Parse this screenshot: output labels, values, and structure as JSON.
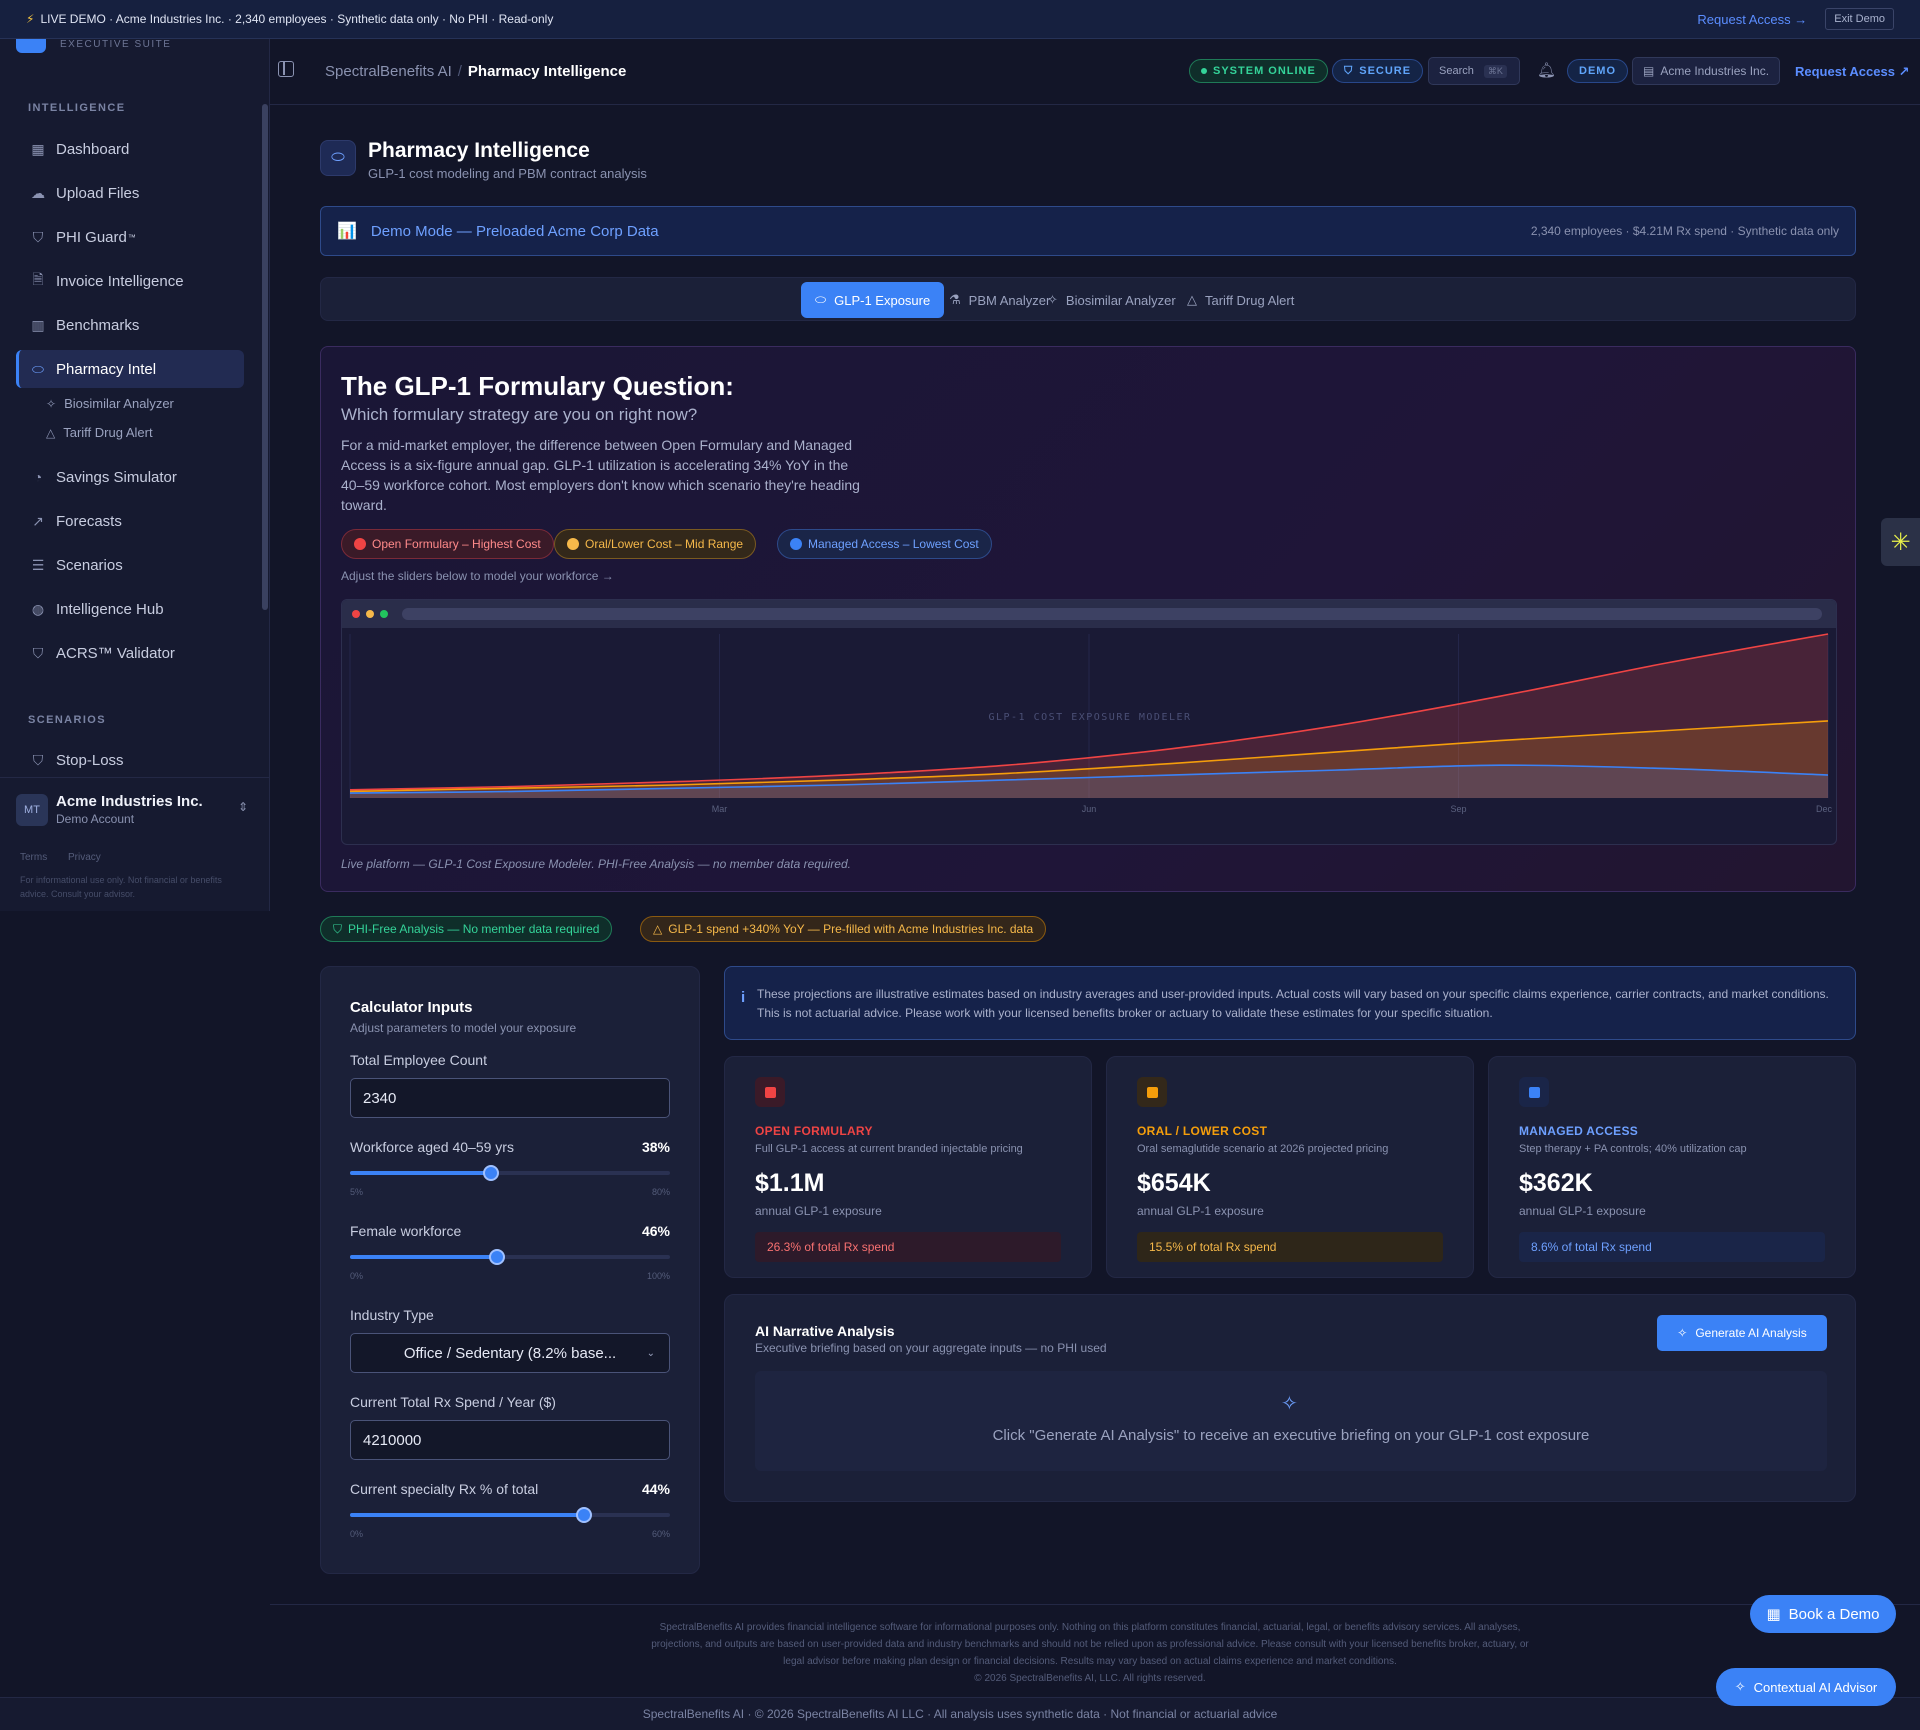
{
  "banner": {
    "text": "LIVE DEMO · Acme Industries Inc. · 2,340 employees · Synthetic data only · No PHI · Read-only",
    "request_access": "Request Access →",
    "exit_demo": "Exit Demo"
  },
  "sidebar": {
    "logo_sub": "EXECUTIVE SUITE",
    "section_intelligence": "INTELLIGENCE",
    "items": [
      {
        "label": "Dashboard",
        "icon": "grid-icon"
      },
      {
        "label": "Upload Files",
        "icon": "cloud-upload-icon"
      },
      {
        "label": "PHI Guard",
        "icon": "shield-icon",
        "sup": "™"
      },
      {
        "label": "Invoice Intelligence",
        "icon": "file-search-icon"
      },
      {
        "label": "Benchmarks",
        "icon": "bar-chart-icon"
      },
      {
        "label": "Pharmacy Intel",
        "icon": "pill-icon"
      },
      {
        "label": "Savings Simulator",
        "icon": "piggy-bank-icon"
      },
      {
        "label": "Forecasts",
        "icon": "trending-up-icon"
      },
      {
        "label": "Scenarios",
        "icon": "list-icon"
      },
      {
        "label": "Intelligence Hub",
        "icon": "globe-icon"
      },
      {
        "label": "ACRS™ Validator",
        "icon": "shield-check-icon"
      }
    ],
    "sub_items": [
      {
        "label": "Biosimilar Analyzer",
        "icon": "sparkle-icon"
      },
      {
        "label": "Tariff Drug Alert",
        "icon": "warning-icon"
      }
    ],
    "section_scenarios": "SCENARIOS",
    "stop_loss": "Stop-Loss",
    "account": {
      "initials": "MT",
      "name": "Acme Industries Inc.",
      "subtitle": "Demo Account"
    },
    "footer_links": [
      "Terms",
      "Privacy"
    ],
    "footer_disclaimer": "For informational use only. Not financial or benefits advice. Consult your advisor."
  },
  "header": {
    "crumb_root": "SpectralBenefits AI",
    "crumb_sep": "/",
    "crumb_current": "Pharmacy Intelligence",
    "status_online": "SYSTEM ONLINE",
    "status_secure": "SECURE",
    "search_label": "Search",
    "search_kbd": "⌘K",
    "demo_pill": "DEMO",
    "org": "Acme Industries Inc.",
    "request_access": "Request Access"
  },
  "page": {
    "title": "Pharmacy Intelligence",
    "subtitle": "GLP-1 cost modeling and PBM contract analysis",
    "demo_mode": "Demo Mode — Preloaded Acme Corp Data",
    "demo_meta": "2,340 employees · $4.21M Rx spend · Synthetic data only"
  },
  "tabs": [
    {
      "label": "GLP-1 Exposure",
      "icon": "pill-icon"
    },
    {
      "label": "PBM Analyzer",
      "icon": "flask-icon"
    },
    {
      "label": "Biosimilar Analyzer",
      "icon": "sparkle-icon"
    },
    {
      "label": "Tariff Drug Alert",
      "icon": "warning-icon"
    }
  ],
  "hero": {
    "title": "The GLP-1 Formulary Question:",
    "question": "Which formulary strategy are you on right now?",
    "body": "For a mid-market employer, the difference between Open Formulary and Managed Access is a six-figure annual gap. GLP-1 utilization is accelerating 34% YoY in the 40–59 workforce cohort. Most employers don't know which scenario they're heading toward.",
    "chip_open": "Open Formulary – Highest Cost",
    "chip_oral": "Oral/Lower Cost – Mid Range",
    "chip_managed": "Managed Access – Lowest Cost",
    "hint": "Adjust the sliders below to model your workforce →",
    "watermark": "GLP-1 COST EXPOSURE MODELER",
    "caption": "Live platform — GLP-1 Cost Exposure Modeler. PHI-Free Analysis — no member data required."
  },
  "chart_data": {
    "type": "area",
    "x": [
      "Mar",
      "Jun",
      "Sep",
      "Dec"
    ],
    "series": [
      {
        "values": [
          5,
          7,
          10,
          14,
          20,
          30,
          44,
          62,
          82,
          100
        ],
        "color": "#ef4444"
      },
      {
        "values": [
          4,
          6,
          8,
          11,
          15,
          21,
          28,
          35,
          41,
          47
        ],
        "color": "#f59e0b"
      },
      {
        "values": [
          3,
          4,
          6,
          8,
          11,
          14,
          17,
          20,
          18,
          14
        ],
        "color": "#3b82f6"
      }
    ]
  },
  "badges": {
    "phi": "PHI-Free Analysis — No member data required",
    "glp": "GLP-1 spend +340% YoY — Pre-filled with Acme Industries Inc. data"
  },
  "calc": {
    "title": "Calculator Inputs",
    "subtitle": "Adjust parameters to model your exposure",
    "employees_label": "Total Employee Count",
    "employees_value": "2340",
    "age_label": "Workforce aged 40–59 yrs",
    "age_value": "38%",
    "age_min": "5%",
    "age_max": "80%",
    "age_fraction": 0.44,
    "female_label": "Female workforce",
    "female_value": "46%",
    "female_min": "0%",
    "female_max": "100%",
    "female_fraction": 0.46,
    "industry_label": "Industry Type",
    "industry_value": "Office / Sedentary (8.2% base...",
    "rx_label": "Current Total Rx Spend / Year ($)",
    "rx_value": "4210000",
    "specialty_label": "Current specialty Rx % of total",
    "specialty_value": "44%",
    "specialty_min": "0%",
    "specialty_max": "60%",
    "specialty_fraction": 0.73
  },
  "disclaimer": "These projections are illustrative estimates based on industry averages and user-provided inputs. Actual costs will vary based on your specific claims experience, carrier contracts, and market conditions. This is not actuarial advice. Please work with your licensed benefits broker or actuary to validate these estimates for your specific situation.",
  "cards": [
    {
      "name": "OPEN FORMULARY",
      "desc": "Full GLP-1 access at current branded injectable pricing",
      "value": "$1.1M",
      "unit": "annual GLP-1 exposure",
      "share": "26.3% of total Rx spend",
      "color": "#ef4444"
    },
    {
      "name": "ORAL / LOWER COST",
      "desc": "Oral semaglutide scenario at 2026 projected pricing",
      "value": "$654K",
      "unit": "annual GLP-1 exposure",
      "share": "15.5% of total Rx spend",
      "color": "#f59e0b"
    },
    {
      "name": "MANAGED ACCESS",
      "desc": "Step therapy + PA controls; 40% utilization cap",
      "value": "$362K",
      "unit": "annual GLP-1 exposure",
      "share": "8.6% of total Rx spend",
      "color": "#3b82f6"
    }
  ],
  "ai": {
    "title": "AI Narrative Analysis",
    "subtitle": "Executive briefing based on your aggregate inputs — no PHI used",
    "button": "Generate AI Analysis",
    "placeholder": "Click \"Generate AI Analysis\" to receive an executive briefing on your GLP-1 cost exposure"
  },
  "legal": {
    "text": "SpectralBenefits AI provides financial intelligence software for informational purposes only. Nothing on this platform constitutes financial, actuarial, legal, or benefits advisory services. All analyses, projections, and outputs are based on user-provided data and industry benchmarks and should not be relied upon as professional advice. Please consult with your licensed benefits broker, actuary, or legal advisor before making plan design or financial decisions. Results may vary based on actual claims experience and market conditions.",
    "copyright": "© 2026 SpectralBenefits AI, LLC. All rights reserved."
  },
  "footer": "SpectralBenefits AI · © 2026 SpectralBenefits AI LLC · All analysis uses synthetic data · Not financial or actuarial advice",
  "fab_book": "Book a Demo",
  "fab_advisor": "Contextual AI Advisor"
}
